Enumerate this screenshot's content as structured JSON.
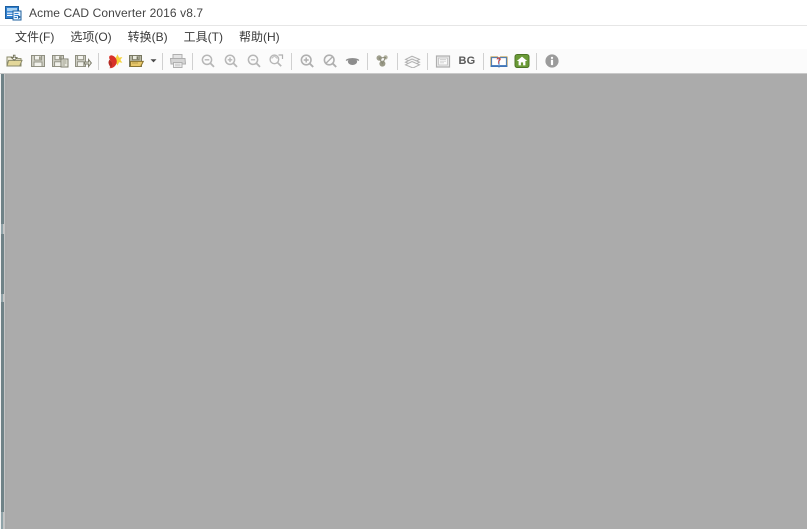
{
  "window": {
    "title": "Acme CAD Converter 2016 v8.7",
    "app_icon": "cad-converter-icon"
  },
  "menu": {
    "items": [
      {
        "label": "文件(F)",
        "name": "menu-file"
      },
      {
        "label": "选项(O)",
        "name": "menu-options"
      },
      {
        "label": "转换(B)",
        "name": "menu-convert"
      },
      {
        "label": "工具(T)",
        "name": "menu-tools"
      },
      {
        "label": "帮助(H)",
        "name": "menu-help"
      }
    ]
  },
  "toolbar": {
    "buttons": [
      {
        "icon": "open-folder-icon",
        "enabled": true
      },
      {
        "icon": "save-icon",
        "enabled": false
      },
      {
        "icon": "save-as-icon",
        "enabled": false
      },
      {
        "icon": "export-icon",
        "enabled": false
      },
      {
        "icon": "pdf-icon",
        "enabled": true
      },
      {
        "icon": "batch-convert-icon",
        "enabled": true
      },
      {
        "icon": "print-icon",
        "enabled": false
      },
      {
        "icon": "zoom-out-icon",
        "enabled": false
      },
      {
        "icon": "zoom-in-icon",
        "enabled": false
      },
      {
        "icon": "zoom-window-icon",
        "enabled": false
      },
      {
        "icon": "zoom-extents-icon",
        "enabled": false
      },
      {
        "icon": "zoom-realtime-icon",
        "enabled": false
      },
      {
        "icon": "zoom-previous-icon",
        "enabled": false
      },
      {
        "icon": "pan-icon",
        "enabled": false
      },
      {
        "icon": "measure-icon",
        "enabled": false
      },
      {
        "icon": "layers-icon",
        "enabled": false
      },
      {
        "icon": "page-setup-icon",
        "enabled": false
      },
      {
        "icon": "background-color-icon",
        "enabled": true
      },
      {
        "icon": "help-book-icon",
        "enabled": true
      },
      {
        "icon": "home-icon",
        "enabled": true
      },
      {
        "icon": "info-icon",
        "enabled": true
      }
    ],
    "background_label": "BG",
    "dropdown_arrow": "chevron-down-icon"
  },
  "colors": {
    "client_background": "#ababab",
    "toolbar_background": "#fbfbfb",
    "title_text": "#444444",
    "accent_blue": "#2f7fd1",
    "pdf_red": "#d8322a",
    "home_green": "#6a9a36",
    "folder_yellow": "#e8c76a"
  },
  "client": {
    "state": "empty-workspace",
    "document_open": false
  }
}
